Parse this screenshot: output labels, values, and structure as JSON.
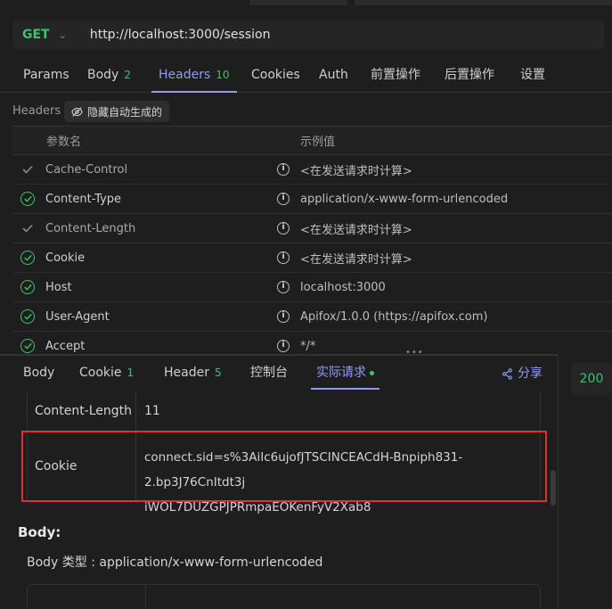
{
  "request": {
    "method": "GET",
    "url": "http://localhost:3000/session"
  },
  "tabs": [
    {
      "label": "Params",
      "count": ""
    },
    {
      "label": "Body",
      "count": "2"
    },
    {
      "label": "Headers",
      "count": "10"
    },
    {
      "label": "Cookies",
      "count": ""
    },
    {
      "label": "Auth",
      "count": ""
    },
    {
      "label": "前置操作",
      "count": ""
    },
    {
      "label": "后置操作",
      "count": ""
    },
    {
      "label": "设置",
      "count": ""
    }
  ],
  "headers_section": {
    "label": "Headers",
    "hide_auto_label": "隐藏自动生成的",
    "col_name": "参数名",
    "col_value": "示例值",
    "rows": [
      {
        "name": "Cache-Control",
        "value": "<在发送请求时计算>",
        "enabled": false
      },
      {
        "name": "Content-Type",
        "value": "application/x-www-form-urlencoded",
        "enabled": true
      },
      {
        "name": "Content-Length",
        "value": "<在发送请求时计算>",
        "enabled": false
      },
      {
        "name": "Cookie",
        "value": "<在发送请求时计算>",
        "enabled": true
      },
      {
        "name": "Host",
        "value": "localhost:3000",
        "enabled": true
      },
      {
        "name": "User-Agent",
        "value": "Apifox/1.0.0 (https://apifox.com)",
        "enabled": true
      },
      {
        "name": "Accept",
        "value": "*/*",
        "enabled": true
      }
    ]
  },
  "response_tabs": [
    {
      "label": "Body",
      "count": ""
    },
    {
      "label": "Cookie",
      "count": "1"
    },
    {
      "label": "Header",
      "count": "5"
    },
    {
      "label": "控制台",
      "count": ""
    },
    {
      "label": "实际请求",
      "count": ""
    }
  ],
  "share_label": "分享",
  "actual_request": {
    "rows": [
      {
        "key": "Content-Length",
        "value": "11"
      },
      {
        "key": "Cookie",
        "value_line1": "connect.sid=s%3AiIc6ujofJTSCINCEACdH-Bnpiph831-2.bp3J76CnItdt3j",
        "value_line2": "iWOL7DUZGPJPRmpaEOKenFyV2Xab8"
      }
    ],
    "body_title": "Body:",
    "body_type": "Body 类型 : application/x-www-form-urlencoded"
  },
  "status_code": "200",
  "colors": {
    "accent": "#8f9cf5",
    "success": "#3cc46c",
    "highlight": "#e03030"
  }
}
